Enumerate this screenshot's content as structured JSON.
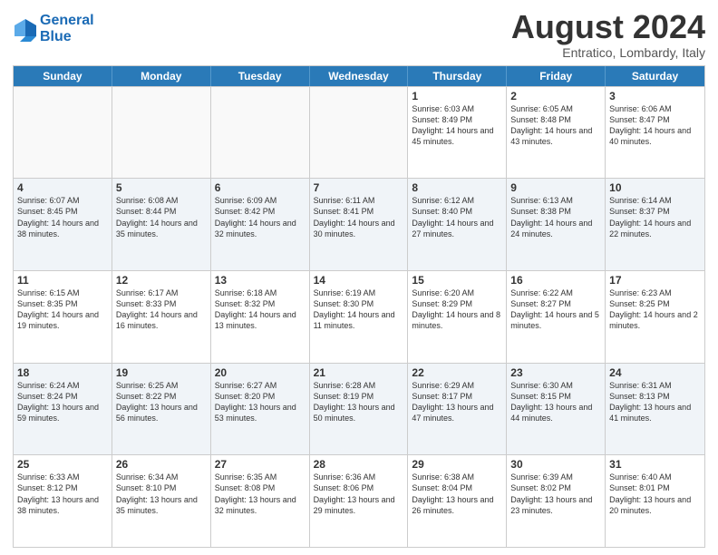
{
  "header": {
    "logo_line1": "General",
    "logo_line2": "Blue",
    "month_title": "August 2024",
    "location": "Entratico, Lombardy, Italy"
  },
  "days_of_week": [
    "Sunday",
    "Monday",
    "Tuesday",
    "Wednesday",
    "Thursday",
    "Friday",
    "Saturday"
  ],
  "rows": [
    [
      {
        "day": "",
        "text": ""
      },
      {
        "day": "",
        "text": ""
      },
      {
        "day": "",
        "text": ""
      },
      {
        "day": "",
        "text": ""
      },
      {
        "day": "1",
        "text": "Sunrise: 6:03 AM\nSunset: 8:49 PM\nDaylight: 14 hours and 45 minutes."
      },
      {
        "day": "2",
        "text": "Sunrise: 6:05 AM\nSunset: 8:48 PM\nDaylight: 14 hours and 43 minutes."
      },
      {
        "day": "3",
        "text": "Sunrise: 6:06 AM\nSunset: 8:47 PM\nDaylight: 14 hours and 40 minutes."
      }
    ],
    [
      {
        "day": "4",
        "text": "Sunrise: 6:07 AM\nSunset: 8:45 PM\nDaylight: 14 hours and 38 minutes."
      },
      {
        "day": "5",
        "text": "Sunrise: 6:08 AM\nSunset: 8:44 PM\nDaylight: 14 hours and 35 minutes."
      },
      {
        "day": "6",
        "text": "Sunrise: 6:09 AM\nSunset: 8:42 PM\nDaylight: 14 hours and 32 minutes."
      },
      {
        "day": "7",
        "text": "Sunrise: 6:11 AM\nSunset: 8:41 PM\nDaylight: 14 hours and 30 minutes."
      },
      {
        "day": "8",
        "text": "Sunrise: 6:12 AM\nSunset: 8:40 PM\nDaylight: 14 hours and 27 minutes."
      },
      {
        "day": "9",
        "text": "Sunrise: 6:13 AM\nSunset: 8:38 PM\nDaylight: 14 hours and 24 minutes."
      },
      {
        "day": "10",
        "text": "Sunrise: 6:14 AM\nSunset: 8:37 PM\nDaylight: 14 hours and 22 minutes."
      }
    ],
    [
      {
        "day": "11",
        "text": "Sunrise: 6:15 AM\nSunset: 8:35 PM\nDaylight: 14 hours and 19 minutes."
      },
      {
        "day": "12",
        "text": "Sunrise: 6:17 AM\nSunset: 8:33 PM\nDaylight: 14 hours and 16 minutes."
      },
      {
        "day": "13",
        "text": "Sunrise: 6:18 AM\nSunset: 8:32 PM\nDaylight: 14 hours and 13 minutes."
      },
      {
        "day": "14",
        "text": "Sunrise: 6:19 AM\nSunset: 8:30 PM\nDaylight: 14 hours and 11 minutes."
      },
      {
        "day": "15",
        "text": "Sunrise: 6:20 AM\nSunset: 8:29 PM\nDaylight: 14 hours and 8 minutes."
      },
      {
        "day": "16",
        "text": "Sunrise: 6:22 AM\nSunset: 8:27 PM\nDaylight: 14 hours and 5 minutes."
      },
      {
        "day": "17",
        "text": "Sunrise: 6:23 AM\nSunset: 8:25 PM\nDaylight: 14 hours and 2 minutes."
      }
    ],
    [
      {
        "day": "18",
        "text": "Sunrise: 6:24 AM\nSunset: 8:24 PM\nDaylight: 13 hours and 59 minutes."
      },
      {
        "day": "19",
        "text": "Sunrise: 6:25 AM\nSunset: 8:22 PM\nDaylight: 13 hours and 56 minutes."
      },
      {
        "day": "20",
        "text": "Sunrise: 6:27 AM\nSunset: 8:20 PM\nDaylight: 13 hours and 53 minutes."
      },
      {
        "day": "21",
        "text": "Sunrise: 6:28 AM\nSunset: 8:19 PM\nDaylight: 13 hours and 50 minutes."
      },
      {
        "day": "22",
        "text": "Sunrise: 6:29 AM\nSunset: 8:17 PM\nDaylight: 13 hours and 47 minutes."
      },
      {
        "day": "23",
        "text": "Sunrise: 6:30 AM\nSunset: 8:15 PM\nDaylight: 13 hours and 44 minutes."
      },
      {
        "day": "24",
        "text": "Sunrise: 6:31 AM\nSunset: 8:13 PM\nDaylight: 13 hours and 41 minutes."
      }
    ],
    [
      {
        "day": "25",
        "text": "Sunrise: 6:33 AM\nSunset: 8:12 PM\nDaylight: 13 hours and 38 minutes."
      },
      {
        "day": "26",
        "text": "Sunrise: 6:34 AM\nSunset: 8:10 PM\nDaylight: 13 hours and 35 minutes."
      },
      {
        "day": "27",
        "text": "Sunrise: 6:35 AM\nSunset: 8:08 PM\nDaylight: 13 hours and 32 minutes."
      },
      {
        "day": "28",
        "text": "Sunrise: 6:36 AM\nSunset: 8:06 PM\nDaylight: 13 hours and 29 minutes."
      },
      {
        "day": "29",
        "text": "Sunrise: 6:38 AM\nSunset: 8:04 PM\nDaylight: 13 hours and 26 minutes."
      },
      {
        "day": "30",
        "text": "Sunrise: 6:39 AM\nSunset: 8:02 PM\nDaylight: 13 hours and 23 minutes."
      },
      {
        "day": "31",
        "text": "Sunrise: 6:40 AM\nSunset: 8:01 PM\nDaylight: 13 hours and 20 minutes."
      }
    ]
  ]
}
